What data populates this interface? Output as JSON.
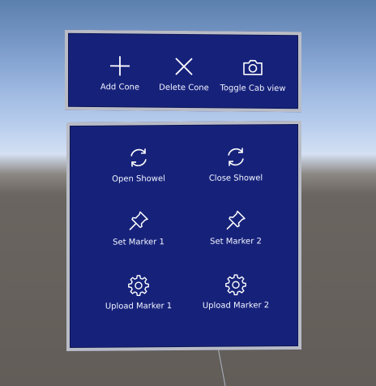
{
  "colors": {
    "panel_background": "#16227a",
    "panel_border": "#b9bcc6",
    "label_text": "#f2f4ff",
    "sky_top": "#5b7fae",
    "ground": "#625d58"
  },
  "top_panel": {
    "buttons": [
      {
        "label": "Add Cone",
        "icon": "plus-icon"
      },
      {
        "label": "Delete Cone",
        "icon": "close-x-icon"
      },
      {
        "label": "Toggle Cab view",
        "icon": "camera-icon"
      }
    ]
  },
  "bottom_panel": {
    "buttons": [
      {
        "label": "Open Showel",
        "icon": "refresh-icon"
      },
      {
        "label": "Close Showel",
        "icon": "refresh-icon"
      },
      {
        "label": "Set Marker 1",
        "icon": "pin-icon"
      },
      {
        "label": "Set Marker 2",
        "icon": "pin-icon"
      },
      {
        "label": "Upload Marker 1",
        "icon": "gear-icon"
      },
      {
        "label": "Upload Marker 2",
        "icon": "gear-icon"
      }
    ]
  }
}
